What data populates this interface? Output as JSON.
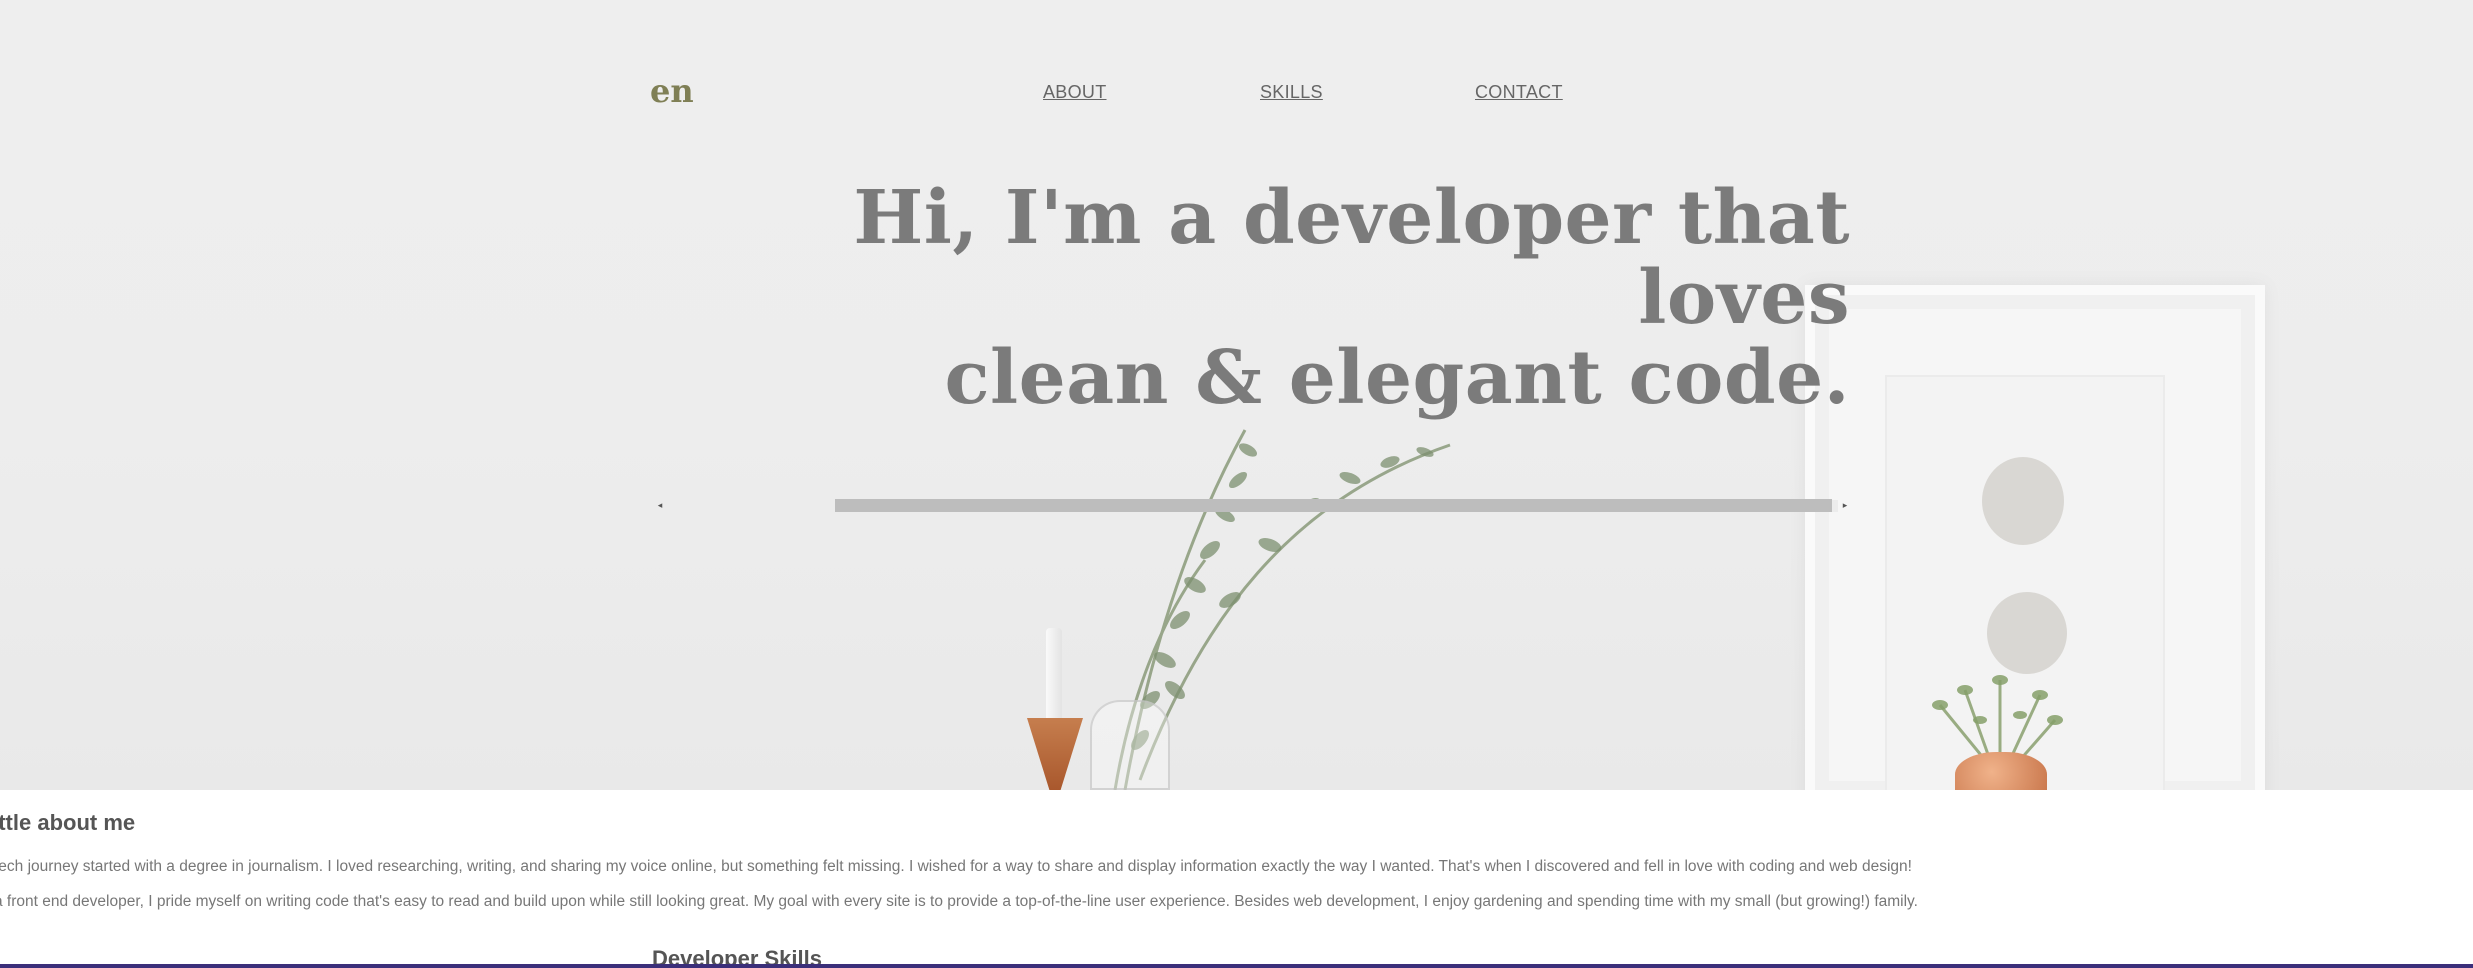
{
  "header": {
    "logo": "en",
    "nav": [
      {
        "label": "ABOUT"
      },
      {
        "label": "SKILLS"
      },
      {
        "label": "CONTACT"
      }
    ]
  },
  "hero": {
    "heading_line1": "Hi, I'm a developer that loves",
    "heading_line2": "clean & elegant code."
  },
  "scrollbar": {
    "left_arrow": "◂",
    "right_arrow": "▸"
  },
  "about": {
    "title": "little about me",
    "paragraph1": "tech journey started with a degree in journalism. I loved researching, writing, and sharing my voice online, but something felt missing. I wished for a way to share and display information exactly the way I wanted. That's when I discovered and fell in love with coding and web design!",
    "paragraph2": "a front end developer, I pride myself on writing code that's easy to read and build upon while still looking great. My goal with every site is to provide a top-of-the-line user experience. Besides web development, I enjoy gardening and spending time with my small (but growing!) family."
  },
  "skills": {
    "title": "Developer Skills"
  },
  "colors": {
    "logo": "#7f7f55",
    "heading": "#7b7b7b",
    "nav": "#666666",
    "accent_line": "#3b2f7a"
  }
}
